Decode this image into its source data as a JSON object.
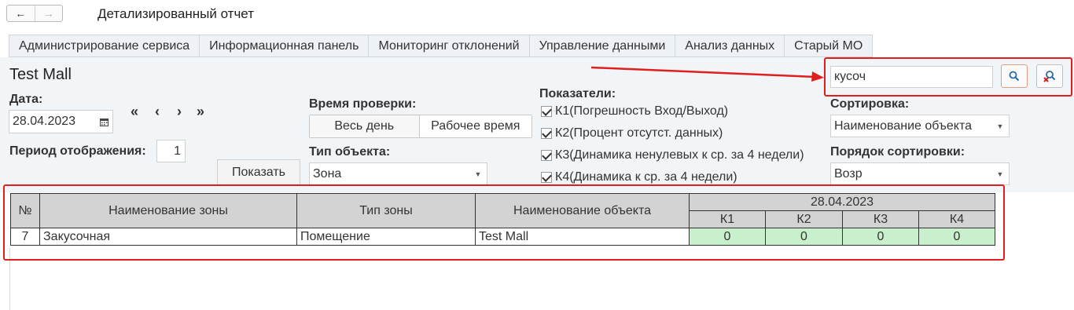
{
  "window": {
    "title": "Детализированный отчет",
    "back_icon": "arrow-left-icon",
    "forward_icon": "arrow-right-icon"
  },
  "tabs": [
    {
      "label": "Администрирование сервиса"
    },
    {
      "label": "Информационная панель"
    },
    {
      "label": "Мониторинг отклонений"
    },
    {
      "label": "Управление данными"
    },
    {
      "label": "Анализ данных"
    },
    {
      "label": "Старый МО"
    }
  ],
  "form": {
    "heading": "Test Mall",
    "date_label": "Дата:",
    "date_value": "28.04.2023",
    "nav": {
      "first": "«",
      "prev": "‹",
      "next": "›",
      "last": "»"
    },
    "period_label": "Период отображения:",
    "period_value": "1",
    "show_button": "Показать",
    "check_time_label": "Время проверки:",
    "check_time_options": [
      "Весь день",
      "Рабочее время"
    ],
    "object_type_label": "Тип объекта:",
    "object_type_value": "Зона",
    "indicators_label": "Показатели:",
    "indicators": [
      {
        "label": "К1(Погрешность Вход/Выход)",
        "checked": true
      },
      {
        "label": "К2(Процент отсутст. данных)",
        "checked": true
      },
      {
        "label": "К3(Динамика ненулевых к ср. за 4 недели)",
        "checked": true
      },
      {
        "label": "К4(Динамика к ср. за 4 недели)",
        "checked": true
      }
    ],
    "search_value": "кусоч",
    "sort_label": "Сортировка:",
    "sort_value": "Наименование объекта",
    "sort_order_label": "Порядок сортировки:",
    "sort_order_value": "Возр"
  },
  "colors": {
    "annotation_red": "#e01e1e",
    "ok_cell": "#c8f0cc",
    "header_gray": "#d3d3d3"
  },
  "table": {
    "headers": {
      "num": "№",
      "zone_name": "Наименование зоны",
      "zone_type": "Тип зоны",
      "object_name": "Наименование объекта",
      "date": "28.04.2023",
      "k": [
        "К1",
        "К2",
        "К3",
        "К4"
      ]
    },
    "rows": [
      {
        "num": "7",
        "zone_name": "Закусочная",
        "zone_type": "Помещение",
        "object_name": "Test Mall",
        "k": [
          "0",
          "0",
          "0",
          "0"
        ]
      }
    ]
  }
}
